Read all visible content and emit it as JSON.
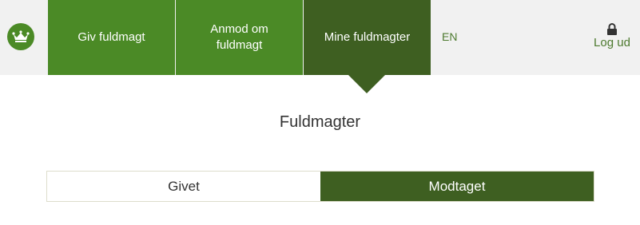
{
  "header": {
    "nav": [
      {
        "label": "Giv fuldmagt"
      },
      {
        "label": "Anmod om fuldmagt"
      },
      {
        "label": "Mine fuldmagter"
      }
    ],
    "language": "EN",
    "logout": "Log ud"
  },
  "main": {
    "title": "Fuldmagter",
    "tabs": [
      {
        "label": "Givet"
      },
      {
        "label": "Modtaget"
      }
    ],
    "active_tab": "Modtaget"
  },
  "colors": {
    "primary_green": "#4b8a26",
    "dark_green": "#3e5f21",
    "header_bg": "#f1f1f1"
  }
}
